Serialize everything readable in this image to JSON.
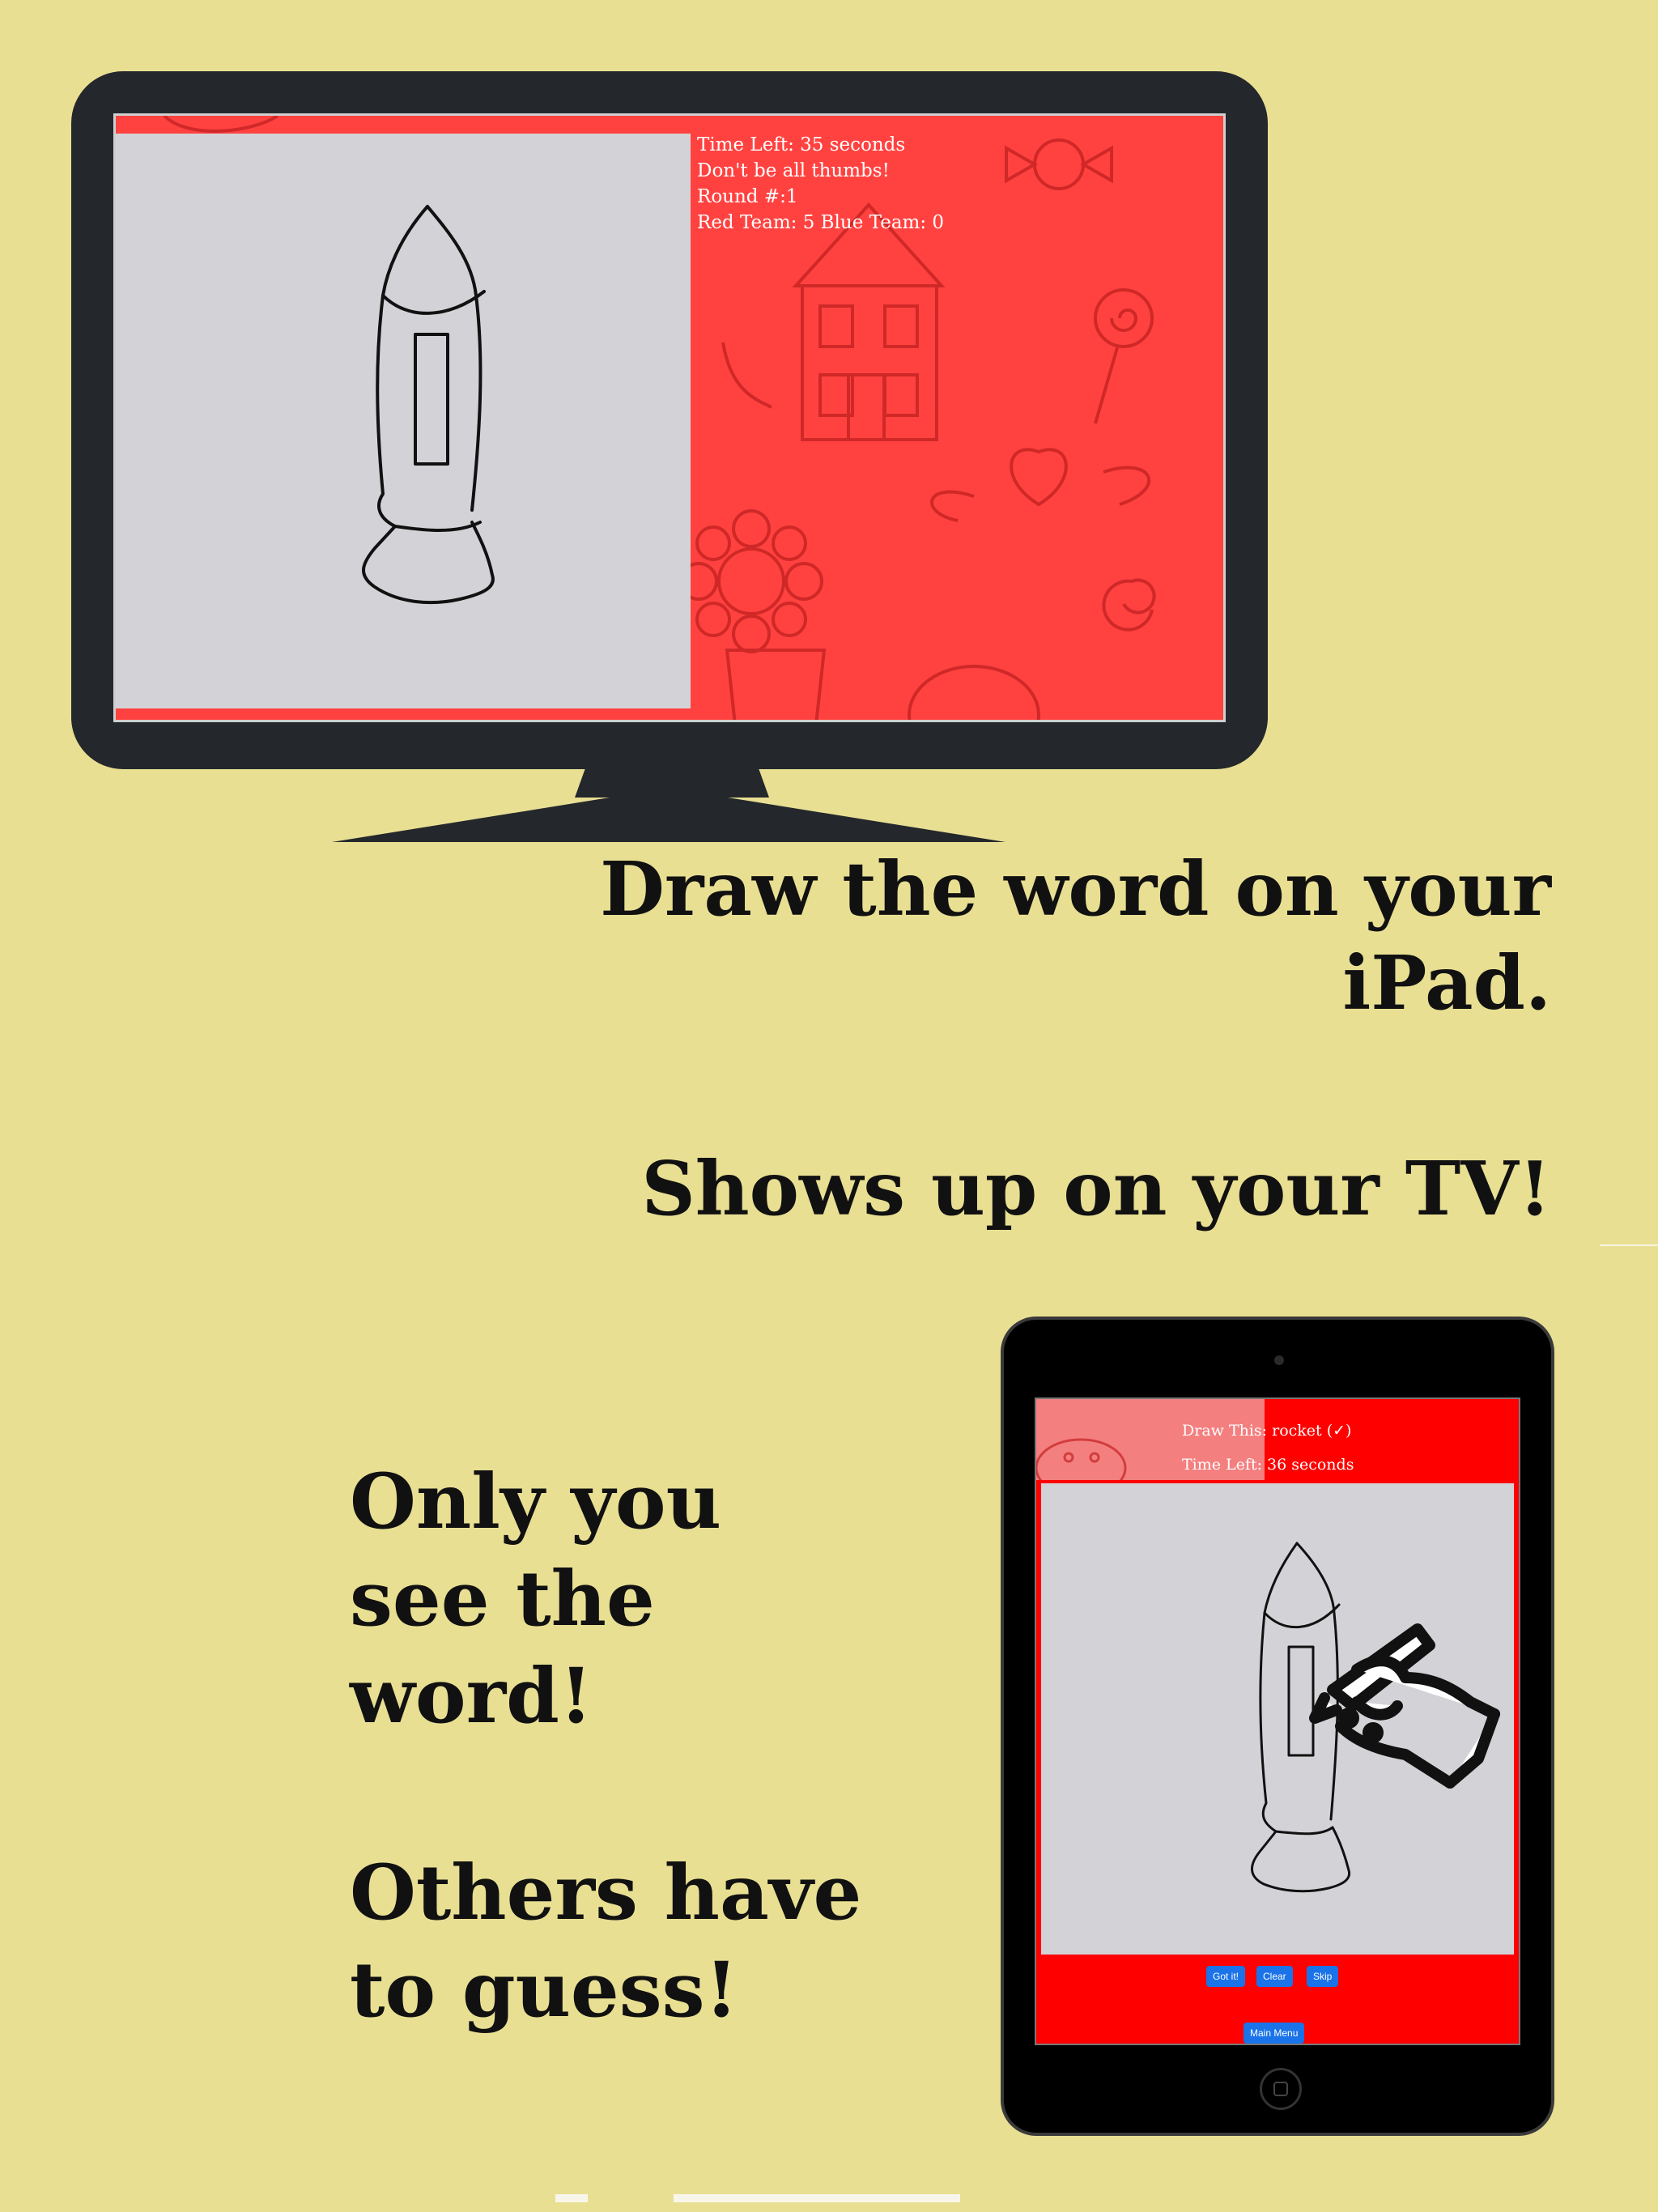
{
  "tv": {
    "time_left": "Time Left: 35 seconds",
    "hint": "Don't be all thumbs!",
    "round": "Round #:1",
    "score": "Red Team: 5 Blue Team: 0"
  },
  "captions": {
    "tv_line1": "Draw the word on your",
    "tv_line2": "iPad.",
    "shows": "Shows up on your TV!",
    "only_line1": "Only you",
    "only_line2": "see the",
    "only_line3": "word!",
    "others_line1": "Others have",
    "others_line2": "to guess!"
  },
  "ipad": {
    "draw_this": "Draw This: rocket (✓)",
    "time_left": "Time Left: 36 seconds",
    "buttons": {
      "got_it": "Got it!",
      "clear": "Clear",
      "skip": "Skip",
      "main_menu": "Main Menu"
    }
  },
  "icons": {
    "hand": "hand-drawing-pencil-icon",
    "rocket": "rocket-drawing"
  },
  "colors": {
    "background": "#e8df93",
    "tv_screen": "#ff4240",
    "ipad_screen": "#ff0000",
    "canvas": "#d3d3d7",
    "button": "#1a73e8"
  }
}
